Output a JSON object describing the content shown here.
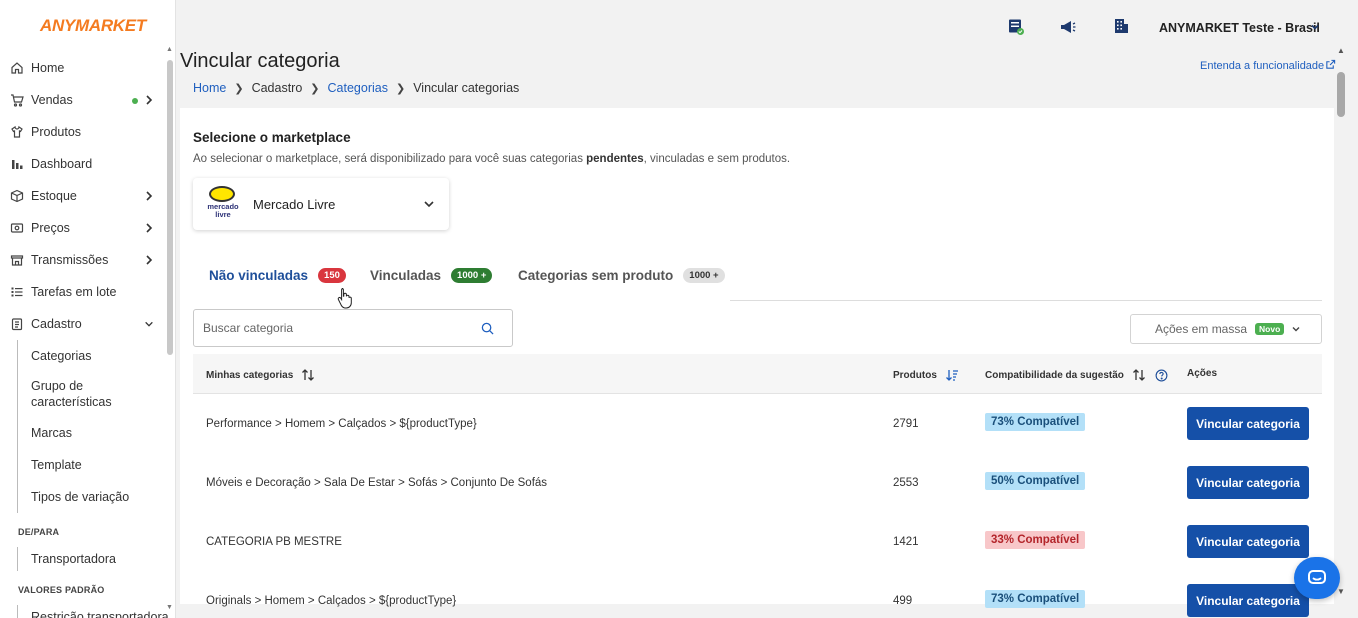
{
  "brand": "ANYMARKET",
  "sidebar": {
    "items": [
      {
        "label": "Home",
        "icon": "home-icon"
      },
      {
        "label": "Vendas",
        "icon": "cart-icon",
        "dot": true,
        "chevron": "right"
      },
      {
        "label": "Produtos",
        "icon": "shirt-icon"
      },
      {
        "label": "Dashboard",
        "icon": "bar-chart-icon"
      },
      {
        "label": "Estoque",
        "icon": "box-icon",
        "chevron": "right"
      },
      {
        "label": "Preços",
        "icon": "price-tag-icon",
        "chevron": "right"
      },
      {
        "label": "Transmissões",
        "icon": "store-icon",
        "chevron": "right"
      },
      {
        "label": "Tarefas em lote",
        "icon": "list-icon"
      },
      {
        "label": "Cadastro",
        "icon": "clipboard-icon",
        "chevron": "down"
      }
    ],
    "cadastro_sub": [
      "Categorias",
      "Grupo de características",
      "Marcas",
      "Template",
      "Tipos de variação"
    ],
    "section_depara": "DE/PARA",
    "depara_items": [
      "Transportadora"
    ],
    "section_valores": "VALORES PADRÃO",
    "valores_items": [
      "Restrição transportadora"
    ]
  },
  "topbar": {
    "account": "ANYMARKET Teste - Brasil",
    "icons": [
      "server-status-icon",
      "megaphone-icon",
      "building-icon"
    ]
  },
  "page": {
    "title": "Vincular categoria",
    "breadcrumb": [
      "Home",
      "Cadastro",
      "Categorias",
      "Vincular categorias"
    ],
    "help_link": "Entenda a funcionalidade"
  },
  "marketplace": {
    "section_title": "Selecione o marketplace",
    "desc_before": "Ao selecionar o marketplace, será disponibilizado para você suas categorias ",
    "desc_bold": "pendentes",
    "desc_after": ", vinculadas e sem produtos.",
    "selected": "Mercado Livre",
    "logo_text": "mercado livre"
  },
  "tabs": [
    {
      "label": "Não vinculadas",
      "count": "150",
      "active": true
    },
    {
      "label": "Vinculadas",
      "count": "1000 +"
    },
    {
      "label": "Categorias sem produto",
      "count": "1000 +"
    }
  ],
  "search": {
    "placeholder": "Buscar categoria"
  },
  "bulk": {
    "label": "Ações em massa",
    "badge": "Novo"
  },
  "table": {
    "headers": {
      "category": "Minhas categorias",
      "products": "Produtos",
      "compat": "Compatibilidade da sugestão",
      "actions": "Ações"
    },
    "action_label": "Vincular categoria",
    "rows": [
      {
        "category": "Performance > Homem > Calçados > ${productType}",
        "products": "2791",
        "compat": "73% Compatível",
        "level": "blue"
      },
      {
        "category": "Móveis e Decoração > Sala De Estar > Sofás > Conjunto De Sofás",
        "products": "2553",
        "compat": "50% Compatível",
        "level": "blue"
      },
      {
        "category": "CATEGORIA PB MESTRE",
        "products": "1421",
        "compat": "33% Compatível",
        "level": "pink"
      },
      {
        "category": "Originals > Homem > Calçados > ${productType}",
        "products": "499",
        "compat": "73% Compatível",
        "level": "blue"
      }
    ]
  },
  "colors": {
    "accent": "#1550a8",
    "brand": "#f47b20",
    "danger": "#d9363e",
    "success": "#2e7d32"
  }
}
